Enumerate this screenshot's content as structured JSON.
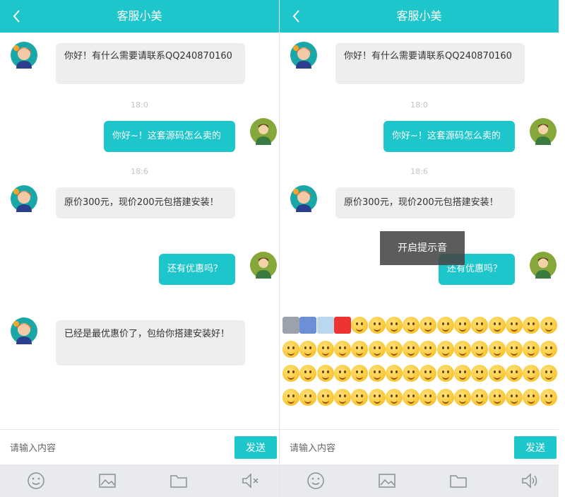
{
  "colors": {
    "accent": "#1cc6ca",
    "incoming_bubble": "#eceeef",
    "toolbar_bg": "#e8eaee"
  },
  "left": {
    "title": "客服小美",
    "messages": [
      {
        "text": "你好！有什么需要请联系QQ240870160"
      },
      {
        "time": "18:0"
      },
      {
        "text": "你好~！这套源码怎么卖的"
      },
      {
        "time": "18:6"
      },
      {
        "text": "原价300元，现价200元包搭建安装！"
      },
      {
        "text": "还有优惠吗？"
      },
      {
        "text": "已经是最优惠价了，包给你搭建安装好！"
      }
    ],
    "input_placeholder": "请输入内容",
    "send_label": "发送",
    "toolbar_icons": [
      "smile-icon",
      "image-icon",
      "folder-icon",
      "speaker-muted-icon"
    ]
  },
  "right": {
    "title": "客服小美",
    "messages": [
      {
        "text": "你好！有什么需要请联系QQ240870160"
      },
      {
        "time": "18:0"
      },
      {
        "text": "你好~！这套源码怎么卖的"
      },
      {
        "time": "18:6"
      },
      {
        "text": "原价300元，现价200元包搭建安装！"
      },
      {
        "text": "还有优惠吗？"
      }
    ],
    "toast": "开启提示音",
    "emoji_rows": 4,
    "emoji_per_row": 16,
    "input_placeholder": "请输入内容",
    "send_label": "发送",
    "toolbar_icons": [
      "smile-icon",
      "image-icon",
      "folder-icon",
      "speaker-icon"
    ]
  }
}
